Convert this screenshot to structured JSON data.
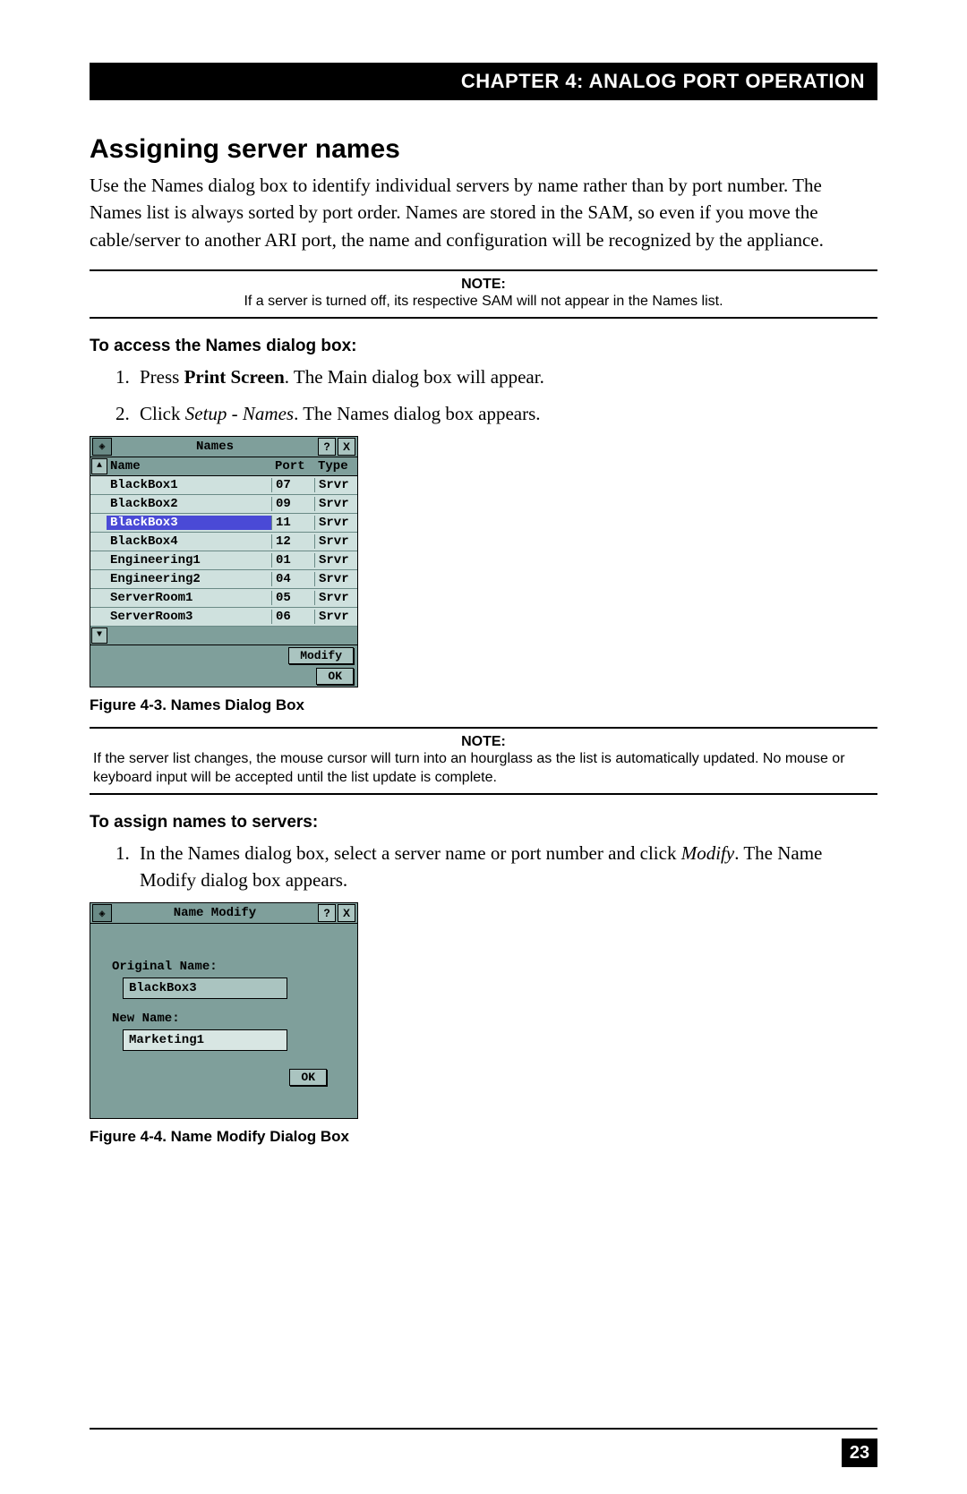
{
  "chapter_bar": "CHAPTER 4: ANALOG PORT OPERATION",
  "section_title": "Assigning server names",
  "intro_paragraph": "Use the Names dialog box to identify individual servers by name rather than by port number. The Names list is always sorted by port order. Names are stored in the SAM, so even if you move the cable/server to another ARI port, the name and configuration will be recognized by the appliance.",
  "note1": {
    "label": "NOTE:",
    "text": "If a server is turned off, its respective SAM will not appear in the Names list."
  },
  "access_heading": "To access the Names dialog box:",
  "step1_a": "Press ",
  "step1_b": "Print Screen",
  "step1_c": ". The Main dialog box will appear.",
  "step2_a": "Click ",
  "step2_b": "Setup - Names",
  "step2_c": ". The Names dialog box appears.",
  "names_dialog": {
    "title": "Names",
    "help_btn": "?",
    "close_btn": "X",
    "sort_arrow": "▲",
    "dn_arrow": "▼",
    "col_name": "Name",
    "col_port": "Port",
    "col_type": "Type",
    "rows": [
      {
        "name": "BlackBox1",
        "port": "07",
        "type": "Srvr",
        "sel": false
      },
      {
        "name": "BlackBox2",
        "port": "09",
        "type": "Srvr",
        "sel": false
      },
      {
        "name": "BlackBox3",
        "port": "11",
        "type": "Srvr",
        "sel": true
      },
      {
        "name": "BlackBox4",
        "port": "12",
        "type": "Srvr",
        "sel": false
      },
      {
        "name": "Engineering1",
        "port": "01",
        "type": "Srvr",
        "sel": false
      },
      {
        "name": "Engineering2",
        "port": "04",
        "type": "Srvr",
        "sel": false
      },
      {
        "name": "ServerRoom1",
        "port": "05",
        "type": "Srvr",
        "sel": false
      },
      {
        "name": "ServerRoom3",
        "port": "06",
        "type": "Srvr",
        "sel": false
      }
    ],
    "modify_btn": "Modify",
    "ok_btn": "OK"
  },
  "fig43_caption": "Figure 4-3. Names Dialog Box",
  "note2": {
    "label": "NOTE:",
    "text": "If the server list changes, the mouse cursor will turn into an hourglass as the list is automatically updated. No mouse or keyboard input will be accepted until the list update is complete."
  },
  "assign_heading": "To assign names to servers:",
  "assign_step1_a": "In the Names dialog box, select a server name or port number and click ",
  "assign_step1_b": "Modify",
  "assign_step1_c": ". The Name Modify dialog box appears.",
  "modify_dialog": {
    "title": "Name Modify",
    "help_btn": "?",
    "close_btn": "X",
    "orig_label": "Original Name:",
    "orig_value": "BlackBox3",
    "new_label": "New Name:",
    "new_value": "Marketing1",
    "ok_btn": "OK"
  },
  "fig44_caption": "Figure 4-4. Name Modify Dialog Box",
  "page_number": "23"
}
